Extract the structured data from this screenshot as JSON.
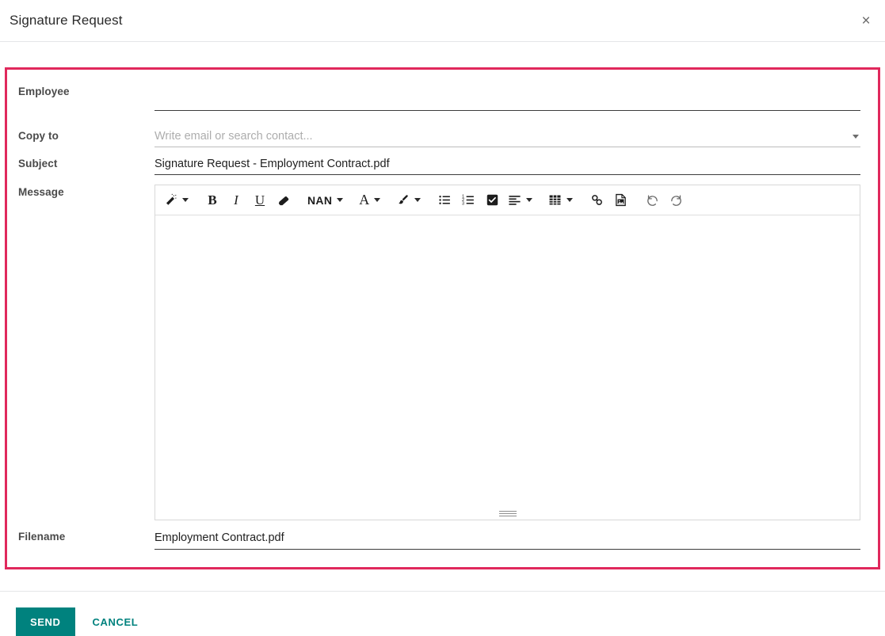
{
  "dialog": {
    "title": "Signature Request",
    "close_label": "×"
  },
  "form": {
    "border_color": "#e0285c",
    "fields": {
      "employee": {
        "label": "Employee",
        "value": "",
        "placeholder": ""
      },
      "copy_to": {
        "label": "Copy to",
        "value": "",
        "placeholder": "Write email or search contact..."
      },
      "subject": {
        "label": "Subject",
        "value": "Signature Request - Employment Contract.pdf",
        "placeholder": ""
      },
      "message": {
        "label": "Message",
        "value": "",
        "placeholder": ""
      },
      "filename": {
        "label": "Filename",
        "value": "Employment Contract.pdf",
        "placeholder": ""
      }
    }
  },
  "editor_toolbar": {
    "items": [
      {
        "name": "magic-wand-icon",
        "label": "",
        "caret": true
      },
      {
        "name": "bold-icon",
        "label": "B",
        "caret": false
      },
      {
        "name": "italic-icon",
        "label": "I",
        "caret": false
      },
      {
        "name": "underline-icon",
        "label": "U",
        "caret": false
      },
      {
        "name": "eraser-icon",
        "label": "",
        "caret": false
      },
      {
        "name": "font-size-selector",
        "label": "NAN",
        "caret": true
      },
      {
        "name": "font-color-icon",
        "label": "A",
        "caret": true
      },
      {
        "name": "highlight-brush-icon",
        "label": "",
        "caret": true
      },
      {
        "name": "unordered-list-icon",
        "label": "",
        "caret": false
      },
      {
        "name": "ordered-list-icon",
        "label": "",
        "caret": false
      },
      {
        "name": "checklist-icon",
        "label": "",
        "caret": false
      },
      {
        "name": "align-icon",
        "label": "",
        "caret": true
      },
      {
        "name": "table-icon",
        "label": "",
        "caret": true
      },
      {
        "name": "link-icon",
        "label": "",
        "caret": false
      },
      {
        "name": "image-icon",
        "label": "",
        "caret": false
      },
      {
        "name": "undo-icon",
        "label": "",
        "caret": false
      },
      {
        "name": "redo-icon",
        "label": "",
        "caret": false
      }
    ]
  },
  "footer": {
    "send_label": "SEND",
    "cancel_label": "CANCEL",
    "accent_color": "#00827e"
  }
}
